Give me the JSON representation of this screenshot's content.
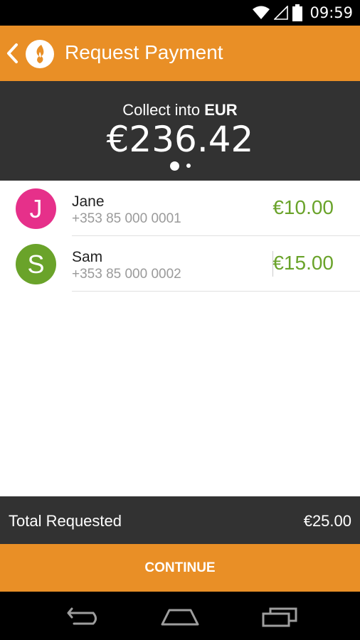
{
  "status_bar": {
    "time": "09:59",
    "icons": [
      "wifi-icon",
      "signal-icon",
      "battery-icon"
    ]
  },
  "app_bar": {
    "title": "Request Payment",
    "back_icon": "back-chevron-icon",
    "logo_icon": "app-logo-icon",
    "background_color": "#e98f26"
  },
  "header": {
    "collect_prefix": "Collect into",
    "currency_code": "EUR",
    "amount": "€236.42",
    "background_color": "#323232",
    "pager_pages": 2,
    "pager_current_page": 1
  },
  "requests": [
    {
      "initial": "J",
      "name": "Jane",
      "phone": "+353 85 000 0001",
      "amount": "€10.00",
      "avatar_color": "#e6308a"
    },
    {
      "initial": "S",
      "name": "Sam",
      "phone": "+353 85 000 0002",
      "amount": "€15.00",
      "avatar_color": "#6aa32a"
    }
  ],
  "amount_color": "#6aa32a",
  "total": {
    "label": "Total Requested",
    "value": "€25.00"
  },
  "continue_button": {
    "label": "CONTINUE"
  },
  "nav_bar": {
    "icons": [
      "back-nav-icon",
      "home-nav-icon",
      "recents-nav-icon"
    ]
  }
}
